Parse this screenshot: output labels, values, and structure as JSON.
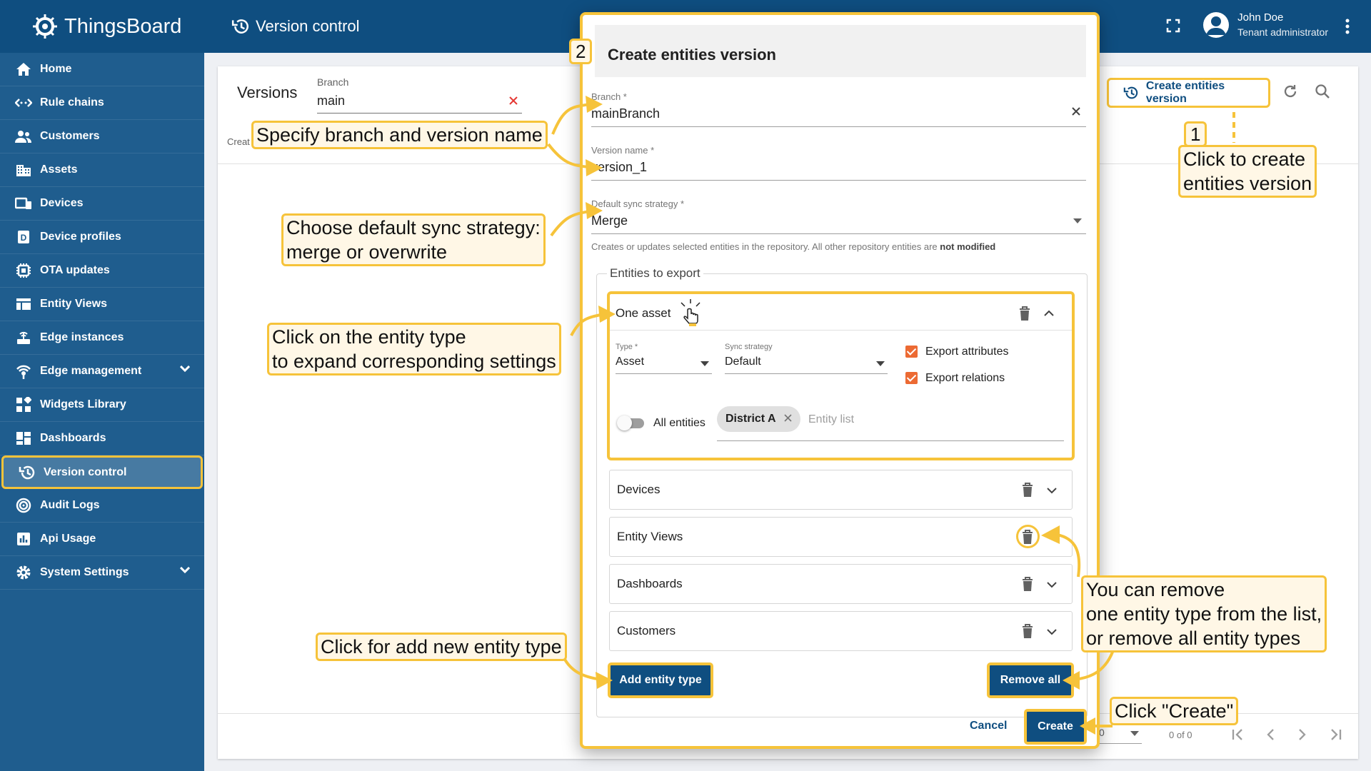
{
  "app": {
    "logo": "ThingsBoard"
  },
  "sidebar": {
    "items": [
      {
        "label": "Home",
        "icon": "home-icon"
      },
      {
        "label": "Rule chains",
        "icon": "rule-chains-icon"
      },
      {
        "label": "Customers",
        "icon": "customers-icon"
      },
      {
        "label": "Assets",
        "icon": "assets-icon"
      },
      {
        "label": "Devices",
        "icon": "devices-icon"
      },
      {
        "label": "Device profiles",
        "icon": "device-profiles-icon"
      },
      {
        "label": "OTA updates",
        "icon": "ota-icon"
      },
      {
        "label": "Entity Views",
        "icon": "entity-views-icon"
      },
      {
        "label": "Edge instances",
        "icon": "edge-instances-icon"
      },
      {
        "label": "Edge management",
        "icon": "edge-management-icon"
      },
      {
        "label": "Widgets Library",
        "icon": "widgets-icon"
      },
      {
        "label": "Dashboards",
        "icon": "dashboards-icon"
      },
      {
        "label": "Version control",
        "icon": "history-icon"
      },
      {
        "label": "Audit Logs",
        "icon": "audit-logs-icon"
      },
      {
        "label": "Api Usage",
        "icon": "api-usage-icon"
      },
      {
        "label": "System Settings",
        "icon": "settings-icon"
      }
    ],
    "active": "Version control"
  },
  "header": {
    "title": "Version control",
    "user_name": "John Doe",
    "user_role": "Tenant administrator"
  },
  "versions_page": {
    "title": "Versions",
    "branch_label": "Branch",
    "branch_value": "main",
    "created_partial": "Creat",
    "create_button": "Create entities version",
    "paginator_page_size": "0",
    "paginator_range": "0 of 0"
  },
  "dialog": {
    "step": "2",
    "title": "Create entities version",
    "branch_label": "Branch *",
    "branch_value": "mainBranch",
    "version_label": "Version name *",
    "version_value": "version_1",
    "sync_label": "Default sync strategy *",
    "sync_value": "Merge",
    "sync_hint": "Creates or updates selected entities in the repository. All other repository entities are",
    "sync_hint_bold": "not modified",
    "entities_legend": "Entities to export",
    "expanded": {
      "name": "One asset",
      "type_label": "Type *",
      "type_value": "Asset",
      "strategy_label": "Sync strategy",
      "strategy_value": "Default",
      "export_attributes": "Export attributes",
      "export_relations": "Export relations",
      "all_entities": "All entities",
      "chip": "District A",
      "entity_list_placeholder": "Entity list"
    },
    "panels": [
      "Devices",
      "Entity Views",
      "Dashboards",
      "Customers"
    ],
    "add_button": "Add entity type",
    "remove_all_button": "Remove all",
    "cancel_button": "Cancel",
    "create_button": "Create"
  },
  "annotations": {
    "step1_number": "1",
    "step1_l1": "Click to create",
    "step1_l2": "entities version",
    "specify": "Specify branch and version name",
    "sync_l1": "Choose default sync strategy:",
    "sync_l2": "merge or overwrite",
    "expand_l1": "Click on the entity type",
    "expand_l2": "to expand corresponding settings",
    "add": "Click for add new entity type",
    "remove_l1": "You can remove",
    "remove_l2": "one entity type from the list,",
    "remove_l3": "or remove all entity types",
    "create": "Click \"Create\""
  },
  "colors": {
    "brand": "#0f4e80",
    "sidebar": "#1f5d8e",
    "highlight": "#f6c33a",
    "checkbox": "#ec6a33"
  }
}
